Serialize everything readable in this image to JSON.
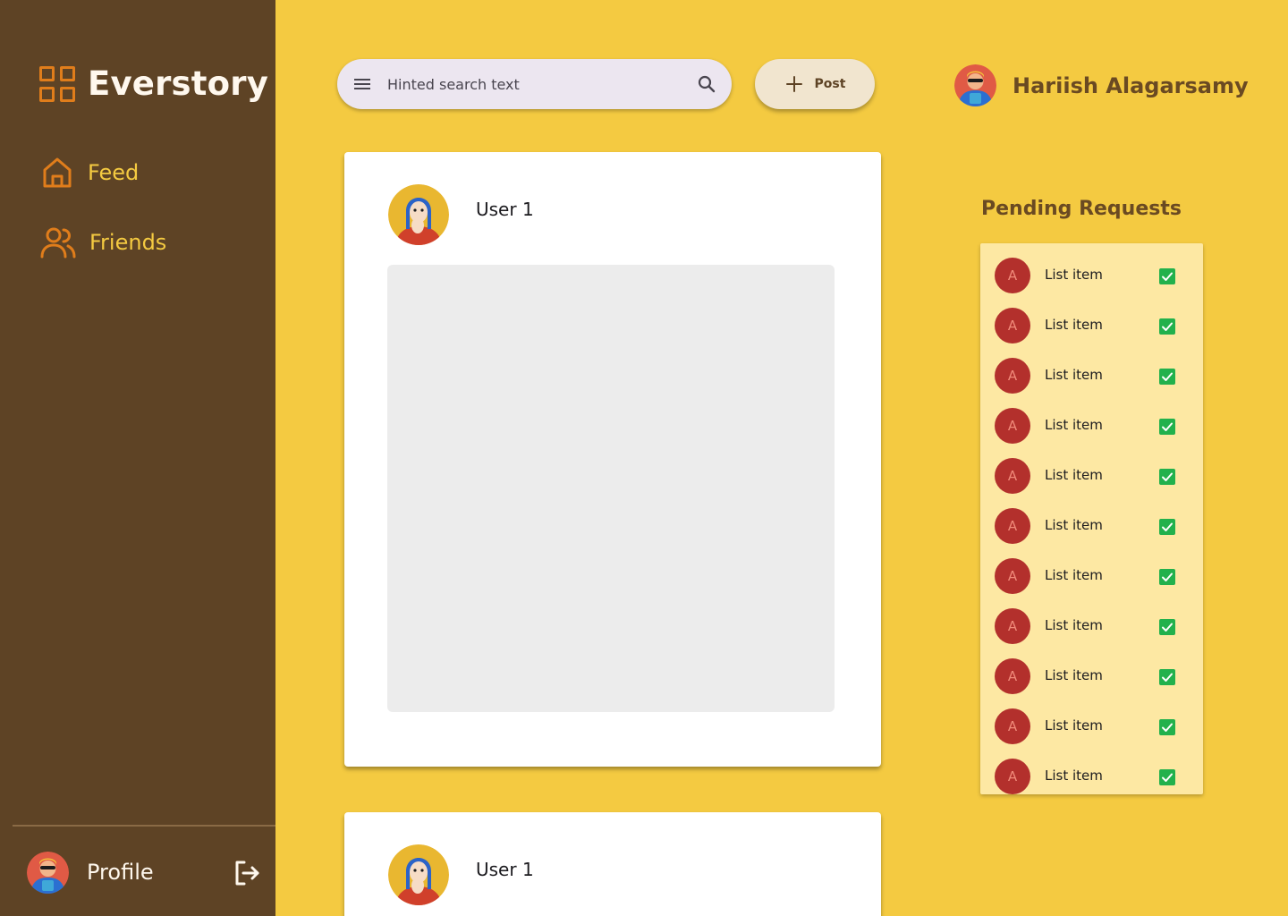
{
  "app": {
    "name": "Everstory"
  },
  "sidebar": {
    "items": [
      {
        "label": "Feed",
        "icon": "home-icon"
      },
      {
        "label": "Friends",
        "icon": "people-icon"
      }
    ],
    "profile_label": "Profile"
  },
  "search": {
    "placeholder": "Hinted search text"
  },
  "toolbar": {
    "post_label": "Post"
  },
  "user": {
    "name": "Hariish Alagarsamy"
  },
  "feed": {
    "posts": [
      {
        "author": "User 1"
      },
      {
        "author": "User 1"
      }
    ]
  },
  "pending": {
    "title": "Pending Requests",
    "items": [
      {
        "initial": "A",
        "label": "List item",
        "checked": true
      },
      {
        "initial": "A",
        "label": "List item",
        "checked": true
      },
      {
        "initial": "A",
        "label": "List item",
        "checked": true
      },
      {
        "initial": "A",
        "label": "List item",
        "checked": true
      },
      {
        "initial": "A",
        "label": "List item",
        "checked": true
      },
      {
        "initial": "A",
        "label": "List item",
        "checked": true
      },
      {
        "initial": "A",
        "label": "List item",
        "checked": true
      },
      {
        "initial": "A",
        "label": "List item",
        "checked": true
      },
      {
        "initial": "A",
        "label": "List item",
        "checked": true
      },
      {
        "initial": "A",
        "label": "List item",
        "checked": true
      },
      {
        "initial": "A",
        "label": "List item",
        "checked": true
      }
    ]
  },
  "colors": {
    "sidebar_bg": "#5e4325",
    "page_bg": "#f4ca41",
    "accent": "#e07d1b",
    "check_green": "#22b14c",
    "request_avatar": "#b3302c"
  }
}
